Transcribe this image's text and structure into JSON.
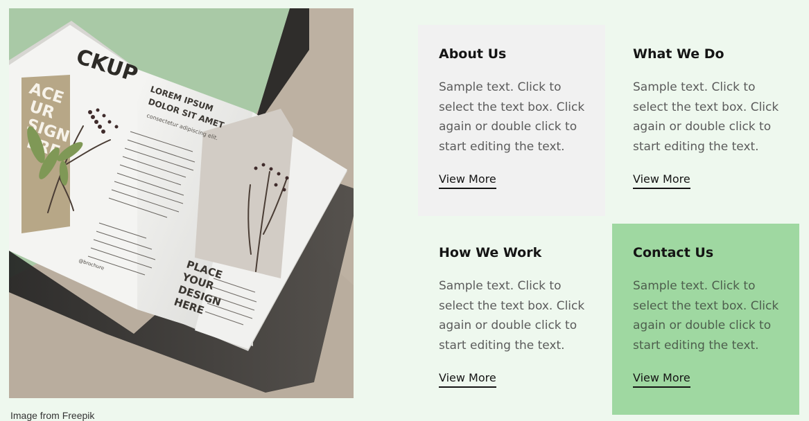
{
  "image": {
    "alt_icon": "brochure-photo",
    "left_heading": "CKUP",
    "left_tagline": "ACE\nUR\nSIGN\nERE",
    "middle_heading": "LOREM IPSUM\nDOLOR SIT AMET",
    "middle_subheading": "consectetur adipiscing elit.",
    "right_heading": "PLACE\nYOUR\nDESIGN\nHERE",
    "social_handle": "@brochure"
  },
  "caption": {
    "prefix": "Image from",
    "link_text": "Freepik"
  },
  "cards": [
    {
      "title": "About Us",
      "text": "Sample text. Click to select the text box. Click again or double click to start editing the text.",
      "link": "View More"
    },
    {
      "title": "What We Do",
      "text": "Sample text. Click to select the text box. Click again or double click to start editing the text.",
      "link": "View More"
    },
    {
      "title": "How We Work",
      "text": "Sample text. Click to select the text box. Click again or double click to start editing the text.",
      "link": "View More"
    },
    {
      "title": "Contact Us",
      "text": "Sample text. Click to select the text box. Click again or double click to start editing the text.",
      "link": "View More"
    }
  ],
  "colors": {
    "page_bg": "#eef8ee",
    "card_gray": "#f1f1f1",
    "card_green": "#9fd8a1",
    "heading": "#141414",
    "body_text": "#5b5b5b"
  }
}
